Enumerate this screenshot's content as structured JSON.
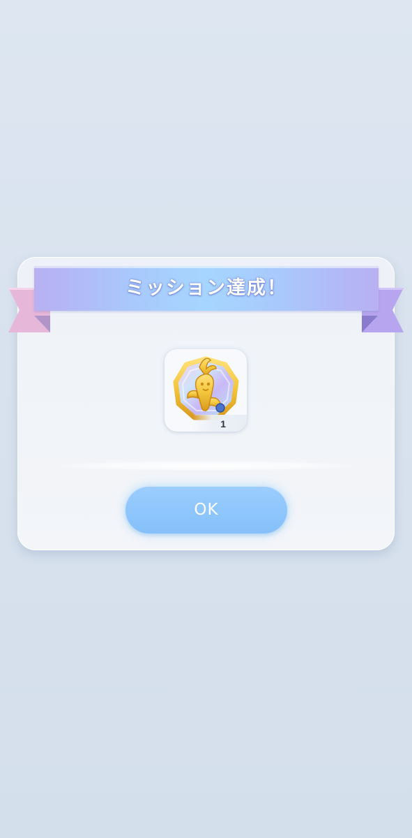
{
  "dialog": {
    "title": "ミッション達成！",
    "reward": {
      "icon": "golden-carrot-medal-icon",
      "quantity": "1"
    },
    "ok_label": "OK"
  },
  "colors": {
    "background": "#d8e2ee",
    "banner_center": "#a6d6ff",
    "banner_edge": "#b8b0f2",
    "ribbon_left": "#e6b7d9",
    "ribbon_right": "#b7a6ef",
    "button": "#8ec6fc",
    "medal_gold": "#f3c63c"
  }
}
